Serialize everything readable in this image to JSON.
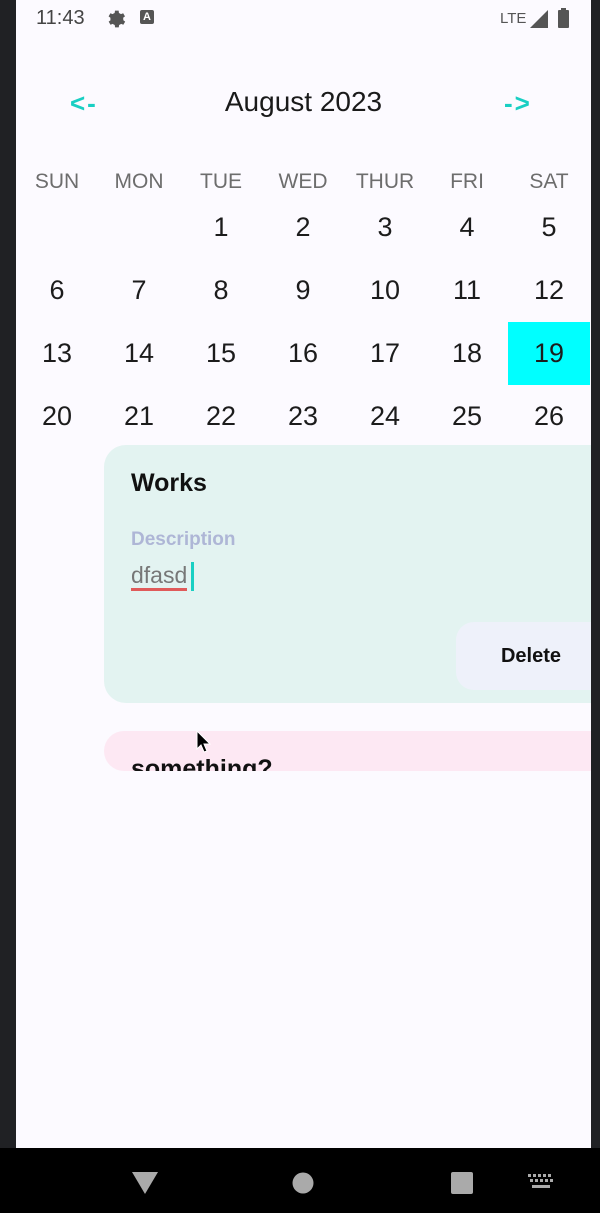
{
  "status_bar": {
    "time": "11:43",
    "network": "LTE",
    "icons": [
      "gear-icon",
      "a-icon",
      "signal-icon",
      "battery-icon"
    ],
    "a_glyph": "A"
  },
  "calendar": {
    "prev_label": "<-",
    "next_label": "->",
    "month_title": "August 2023",
    "accent_color": "#19cfc3",
    "selected_color": "#00ffff",
    "weekdays": [
      "SUN",
      "MON",
      "TUE",
      "WED",
      "THUR",
      "FRI",
      "SAT"
    ],
    "weeks": [
      [
        "",
        "",
        "1",
        "2",
        "3",
        "4",
        "5"
      ],
      [
        "6",
        "7",
        "8",
        "9",
        "10",
        "11",
        "12"
      ],
      [
        "13",
        "14",
        "15",
        "16",
        "17",
        "18",
        "19"
      ],
      [
        "20",
        "21",
        "22",
        "23",
        "24",
        "25",
        "26"
      ]
    ],
    "selected_day": "19"
  },
  "events": [
    {
      "title": "Works",
      "description_label": "Description",
      "description_value": "dfasd",
      "delete_label": "Delete",
      "background": "#e3f3f1"
    },
    {
      "title": "something?",
      "background": "#fde8f3"
    }
  ],
  "nav_bar": {
    "buttons": [
      "back-icon",
      "home-icon",
      "recents-icon",
      "keyboard-icon"
    ]
  }
}
